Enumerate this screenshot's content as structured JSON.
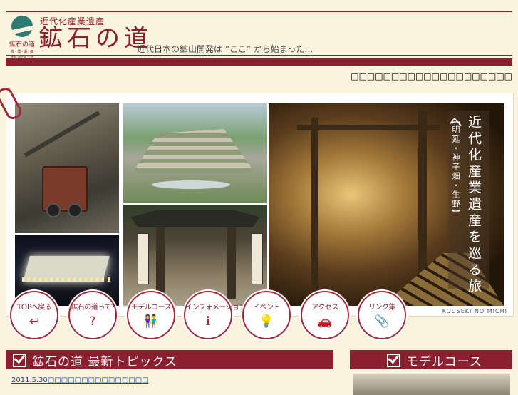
{
  "header": {
    "kicker": "近代化産業遺産",
    "title": "鉱石の道",
    "tagline": "近代日本の鉱山開発は “ここ” から始まった…",
    "logo_line1": "鉱石の道",
    "logo_line2": "産・業・遺・産",
    "logo_line3": "明延 神子畑 生野",
    "marquee": "□□□□□□□□□□□□□□□□□□□□"
  },
  "hero": {
    "vertical_sub": "【明延・神子畑・生野】",
    "vertical_main": "近代化産業遺産を巡る旅へ",
    "footer_tag": "KOUSEKI NO MICHI"
  },
  "nav": [
    {
      "label": "TOPへ戻る",
      "icon": "↩"
    },
    {
      "label": "鉱石の道って?",
      "icon": "?"
    },
    {
      "label": "モデルコース",
      "icon": "👫"
    },
    {
      "label": "インフォメーション",
      "icon": "ℹ"
    },
    {
      "label": "イベント",
      "icon": "💡"
    },
    {
      "label": "アクセス",
      "icon": "🚗"
    },
    {
      "label": "リンク集",
      "icon": "📎"
    }
  ],
  "topics": {
    "title": "鉱石の道  最新トピックス",
    "items": [
      "2011.5.30□□□□□□□□□□□□□□□"
    ]
  },
  "model_course": {
    "title": "モデルコース"
  },
  "colors": {
    "brand": "#8a1f2e",
    "background": "#fbf3dd"
  }
}
